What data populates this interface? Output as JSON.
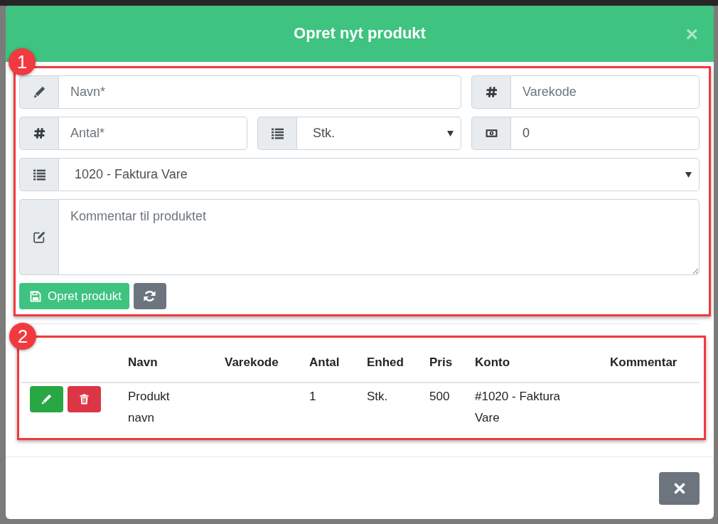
{
  "modal": {
    "title": "Opret nyt produkt",
    "close_symbol": "×",
    "form": {
      "name_field": {
        "placeholder": "Navn*"
      },
      "code_field": {
        "placeholder": "Varekode"
      },
      "quantity_field": {
        "placeholder": "Antal*"
      },
      "unit_select": {
        "value": "Stk."
      },
      "price_field": {
        "value": "0"
      },
      "account_select": {
        "value": "1020 - Faktura Vare"
      },
      "comment_field": {
        "placeholder": "Kommentar til produktet"
      },
      "create_button": {
        "label": "Opret produkt"
      }
    },
    "table": {
      "columns": [
        "Navn",
        "Varekode",
        "Antal",
        "Enhed",
        "Pris",
        "Konto",
        "Kommentar"
      ],
      "rows": [
        {
          "cells": [
            "Produkt navn",
            null,
            "1",
            "Stk.",
            "500",
            "#1020 - Faktura Vare",
            null
          ]
        }
      ]
    }
  },
  "annotations": [
    {
      "number": "1"
    },
    {
      "number": "2"
    }
  ]
}
